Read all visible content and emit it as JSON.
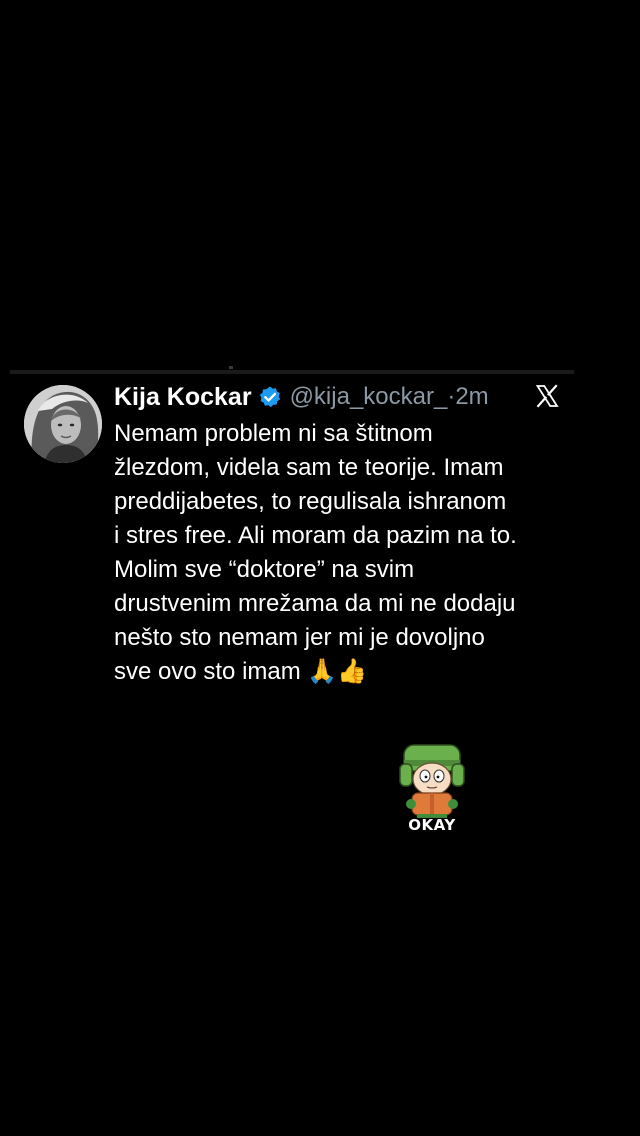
{
  "tweet": {
    "display_name": "Kija Kockar",
    "handle": "@kija_kockar_",
    "separator": " · ",
    "time": "2m",
    "text_lines": [
      "Nemam problem ni sa štitnom",
      "žlezdom, videla sam te teorije.  Imam",
      "preddijabetes, to regulisala ishranom",
      "i stres free. Ali moram da pazim na to.",
      "Molim sve “doktore” na svim",
      "drustvenim mrežama da mi ne dodaju",
      "nešto sto nemam jer mi je dovoljno",
      "sve ovo sto imam 🙏👍"
    ]
  },
  "icons": {
    "verified": "verified-badge-icon",
    "brand": "x-logo-icon"
  },
  "sticker": {
    "caption": "OKAY"
  },
  "colors": {
    "background": "#000000",
    "text": "#ffffff",
    "secondary_text": "#8b98a5",
    "verified_blue": "#1d9bf0",
    "sticker_hat": "#6ab04c"
  }
}
